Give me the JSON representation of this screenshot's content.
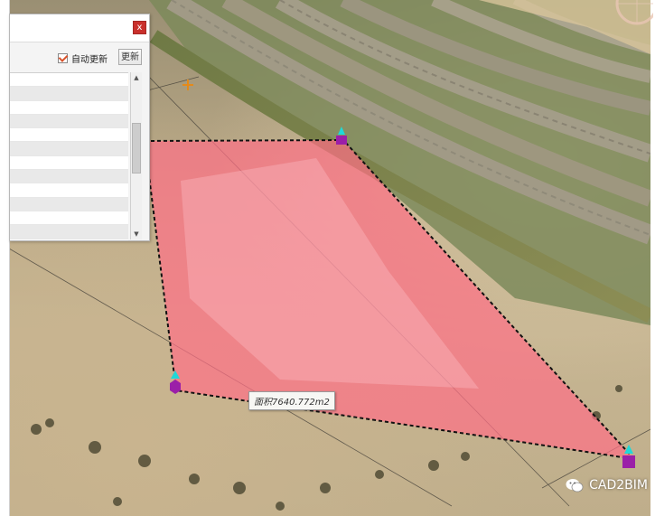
{
  "panel": {
    "close_label": "x",
    "auto_update_label": "自动更新",
    "auto_update_checked": true,
    "update_button_label": "更新",
    "rows": 12
  },
  "measurement": {
    "area_label": "面积7640.772m2",
    "fill_color": "#ff6f86"
  },
  "watermark": {
    "text": "CAD2BIM",
    "icon": "wechat-icon"
  },
  "colors": {
    "vertex_marker": "#9b1fa8",
    "vertex_tip": "#1fd8d8",
    "polygon_outline": "#111111"
  }
}
